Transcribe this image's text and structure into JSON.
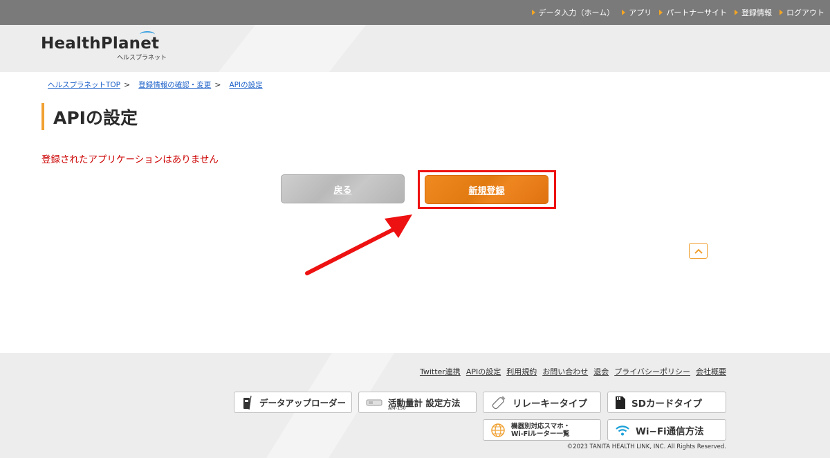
{
  "top_nav": [
    "データ入力（ホーム）",
    "アプリ",
    "パートナーサイト",
    "登録情報",
    "ログアウト"
  ],
  "logo": {
    "main": "HealthPlanet",
    "sub": "ヘルスプラネット"
  },
  "breadcrumb": {
    "items": [
      "ヘルスプラネットTOP",
      "登録情報の確認・変更",
      "APIの設定"
    ],
    "separator": ">"
  },
  "page_title": "APIの設定",
  "notice": "登録されたアプリケーションはありません",
  "buttons": {
    "back": "戻る",
    "new_register": "新規登録"
  },
  "footer": {
    "links": [
      "Twitter連携",
      "APIの設定",
      "利用規約",
      "お問い合わせ",
      "退会",
      "プライバシーポリシー",
      "会社概要"
    ],
    "tiles": {
      "uploader": "データアップローダー",
      "activity": "活動量計 設定方法",
      "activity_model": "AM-150",
      "relay": "リレーキータイプ",
      "sd": "SDカードタイプ",
      "models_line1": "機器別対応スマホ・",
      "models_line2": "Wi-Fiルーター一覧",
      "wifi": "Wi−Fi通信方法"
    },
    "copyright": "©2023 TANITA HEALTH LINK, INC. All Rights Reserved."
  },
  "colors": {
    "accent": "#f0a030",
    "orange_button": "#e27a12",
    "error_text": "#cc0000",
    "highlight": "#ee1111"
  }
}
